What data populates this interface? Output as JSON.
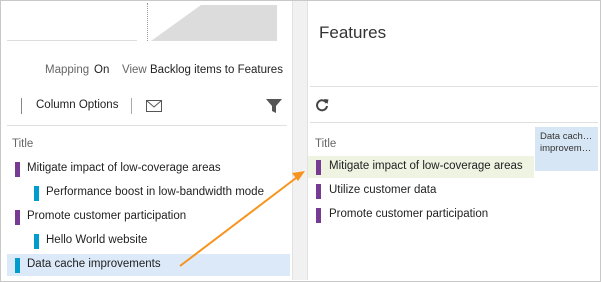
{
  "colors": {
    "feature": "#773b93",
    "backlog_item": "#009ccc",
    "selected_row": "#dbe9f8",
    "drag_arrow": "#f7941d"
  },
  "mapping": {
    "mapping_label": "Mapping",
    "mapping_value": "On",
    "view_label": "View",
    "view_value": "Backlog items to Features"
  },
  "toolbar": {
    "column_options": "Column Options",
    "mail_icon": "mail-icon",
    "filter_icon": "filter-icon"
  },
  "backlog": {
    "column_title": "Title",
    "items": [
      {
        "title": "Mitigate impact of low-coverage areas",
        "type": "feature",
        "level": 0
      },
      {
        "title": "Performance boost in low-bandwidth mode",
        "type": "backlog_item",
        "level": 1
      },
      {
        "title": "Promote customer participation",
        "type": "feature",
        "level": 0
      },
      {
        "title": "Hello World website",
        "type": "backlog_item",
        "level": 1
      },
      {
        "title": "Data cache improvements",
        "type": "backlog_item",
        "level": 0,
        "selected": true
      }
    ]
  },
  "features": {
    "title": "Features",
    "refresh_icon": "refresh-icon",
    "column_title": "Title",
    "drag_tile_lines": [
      "Data cach…",
      "improvem…"
    ],
    "items": [
      {
        "title": "Mitigate impact of low-coverage areas",
        "drop_target": true
      },
      {
        "title": "Utilize customer data"
      },
      {
        "title": "Promote customer participation"
      }
    ]
  }
}
